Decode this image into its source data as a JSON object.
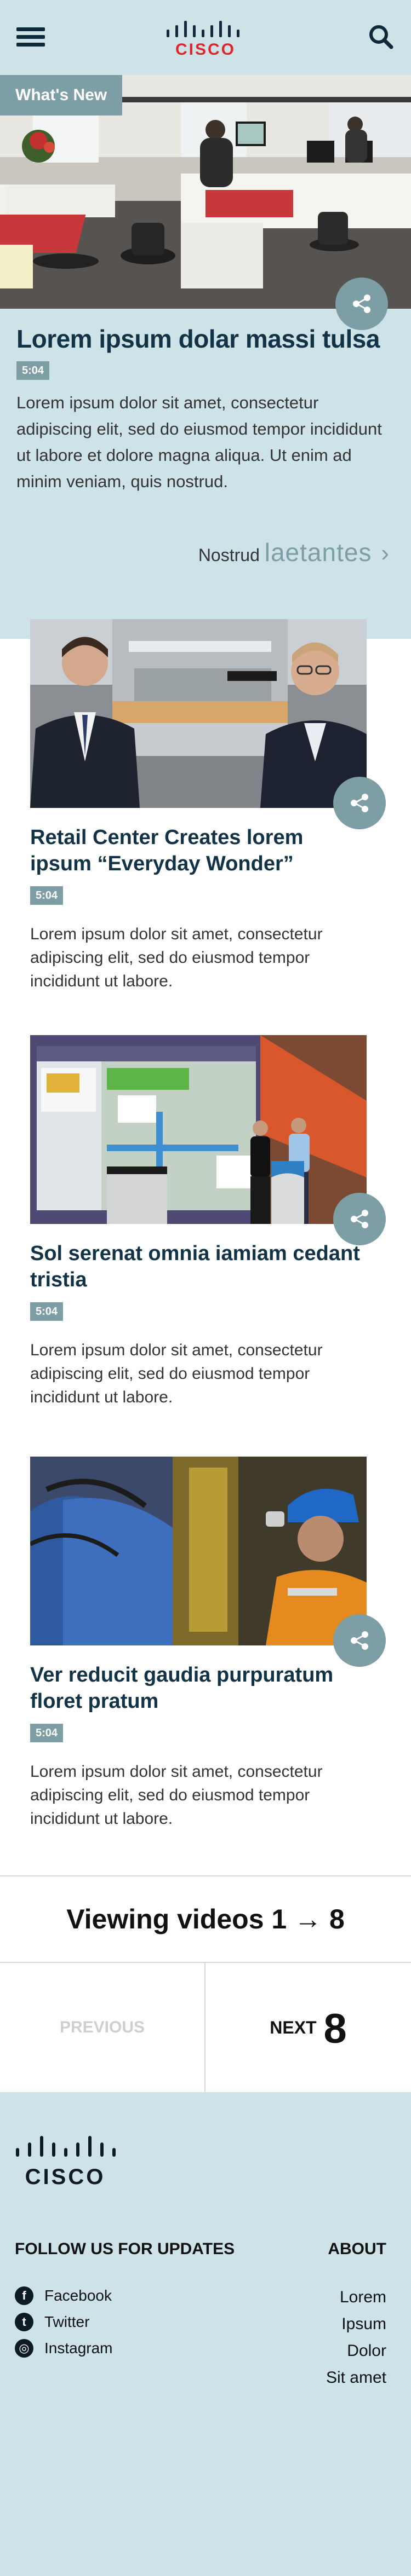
{
  "header": {
    "logo_text": "CISCO"
  },
  "hero": {
    "label": "What's New",
    "title": "Lorem ipsum dolar massi tulsa",
    "duration": "5:04",
    "description": "Lorem ipsum dolor sit amet, consectetur adipiscing elit, sed do eiusmod tempor incididunt ut labore et dolore magna aliqua. Ut enim ad minim veniam, quis nostrud.",
    "cta_small": "Nostrud",
    "cta_big": "laetantes",
    "cta_chevron": "›"
  },
  "videos": [
    {
      "title": "Retail Center Creates lorem ipsum “Everyday Wonder”",
      "duration": "5:04",
      "description": "Lorem ipsum dolor sit amet, consectetur adipiscing elit, sed do eiusmod tempor incididunt ut labore."
    },
    {
      "title": "Sol serenat omnia iamiam cedant tristia",
      "duration": "5:04",
      "description": "Lorem ipsum dolor sit amet, consectetur adipiscing elit, sed do eiusmod tempor incididunt ut labore."
    },
    {
      "title": "Ver reducit gaudia purpuratum floret pratum",
      "duration": "5:04",
      "description": "Lorem ipsum dolor sit amet, consectetur adipiscing elit, sed do eiusmod tempor incididunt ut labore."
    }
  ],
  "pagination": {
    "viewing": "Viewing videos 1 → 8",
    "previous": "PREVIOUS",
    "next": "NEXT",
    "next_number": "8"
  },
  "footer": {
    "logo_text": "CISCO",
    "follow_heading": "FOLLOW US FOR UPDATES",
    "social": [
      {
        "label": "Facebook",
        "icon": "facebook-icon",
        "glyph": "f"
      },
      {
        "label": "Twitter",
        "icon": "twitter-icon",
        "glyph": "t"
      },
      {
        "label": "Instagram",
        "icon": "instagram-icon",
        "glyph": "◎"
      }
    ],
    "about_heading": "ABOUT",
    "about_links": [
      "Lorem",
      "Ipsum",
      "Dolor",
      "Sit amet"
    ]
  },
  "colors": {
    "background_tint": "#cde3e7",
    "accent": "#7c9ea4",
    "brand_red": "#e0242f",
    "title_navy": "#123246"
  }
}
